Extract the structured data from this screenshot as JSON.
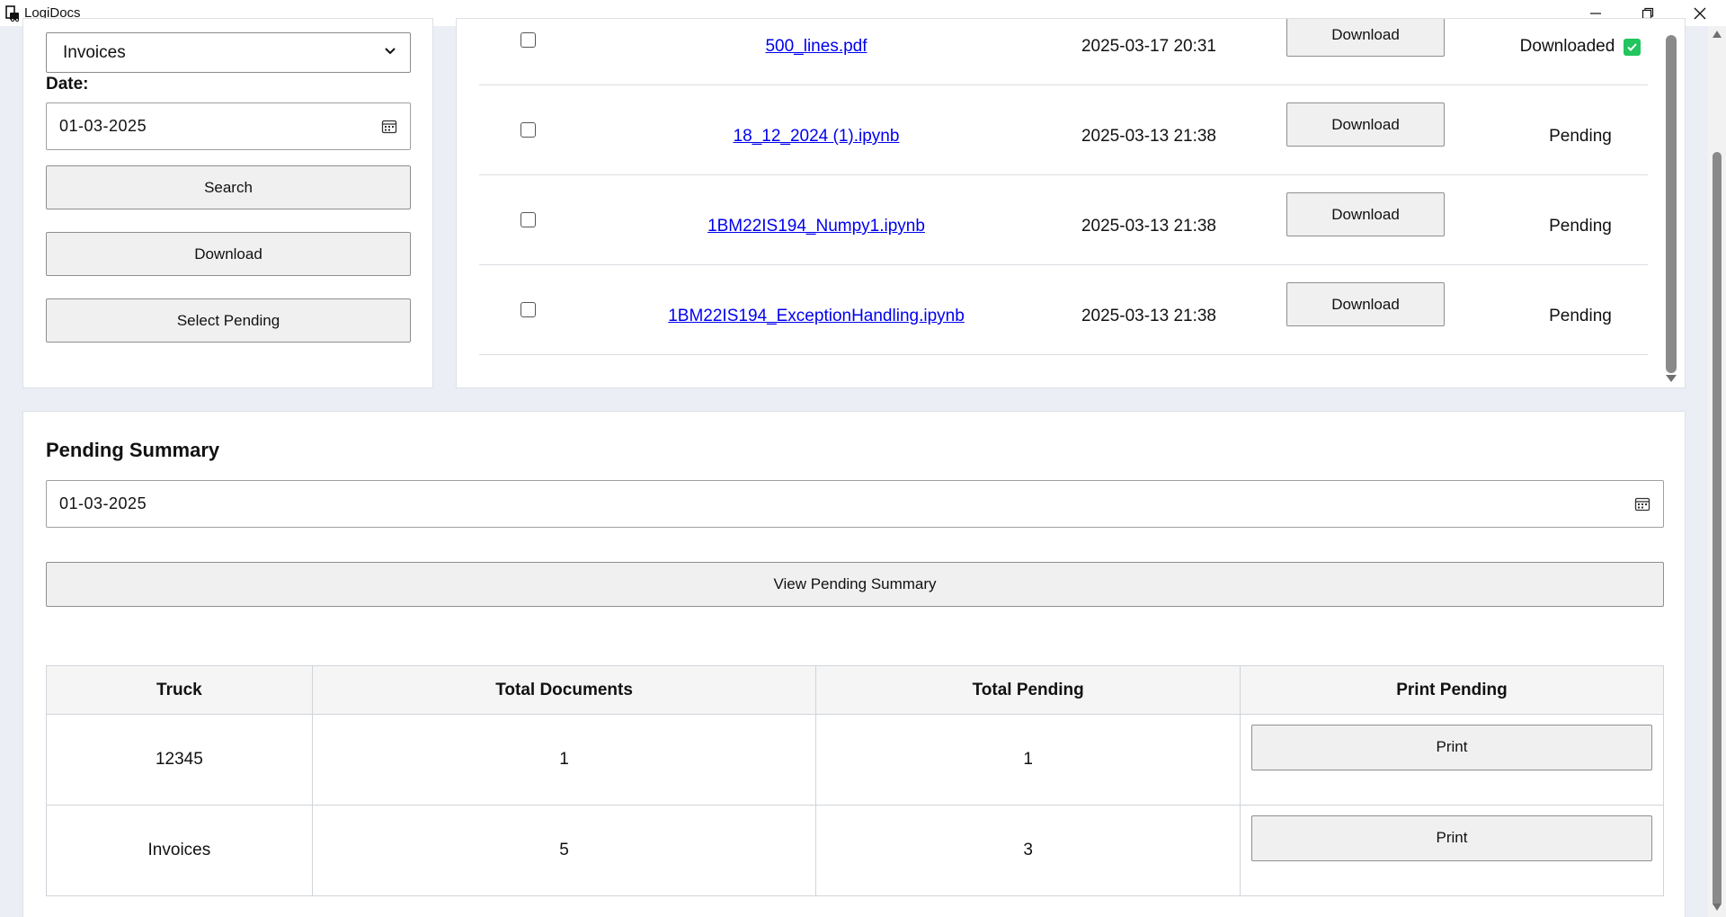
{
  "app": {
    "title": "LogiDocs"
  },
  "filters": {
    "category_value": "Invoices",
    "date_label": "Date:",
    "date_value": "01-03-2025",
    "search_label": "Search",
    "download_label": "Download",
    "select_pending_label": "Select Pending"
  },
  "files": [
    {
      "name": "500_lines.pdf",
      "date": "2025-03-17 20:31",
      "action": "Download",
      "status": "Downloaded"
    },
    {
      "name": "18_12_2024 (1).ipynb",
      "date": "2025-03-13 21:38",
      "action": "Download",
      "status": "Pending"
    },
    {
      "name": "1BM22IS194_Numpy1.ipynb",
      "date": "2025-03-13 21:38",
      "action": "Download",
      "status": "Pending"
    },
    {
      "name": "1BM22IS194_ExceptionHandling.ipynb",
      "date": "2025-03-13 21:38",
      "action": "Download",
      "status": "Pending"
    }
  ],
  "summary": {
    "title": "Pending Summary",
    "date_value": "01-03-2025",
    "view_label": "View Pending Summary",
    "headers": [
      "Truck",
      "Total Documents",
      "Total Pending",
      "Print Pending"
    ],
    "rows": [
      {
        "truck": "12345",
        "total_documents": "1",
        "total_pending": "1",
        "action": "Print"
      },
      {
        "truck": "Invoices",
        "total_documents": "5",
        "total_pending": "3",
        "action": "Print"
      }
    ]
  },
  "colors": {
    "link": "#0000ee",
    "downloaded_badge": "#22c55e",
    "page_bg": "#ebeef4"
  }
}
